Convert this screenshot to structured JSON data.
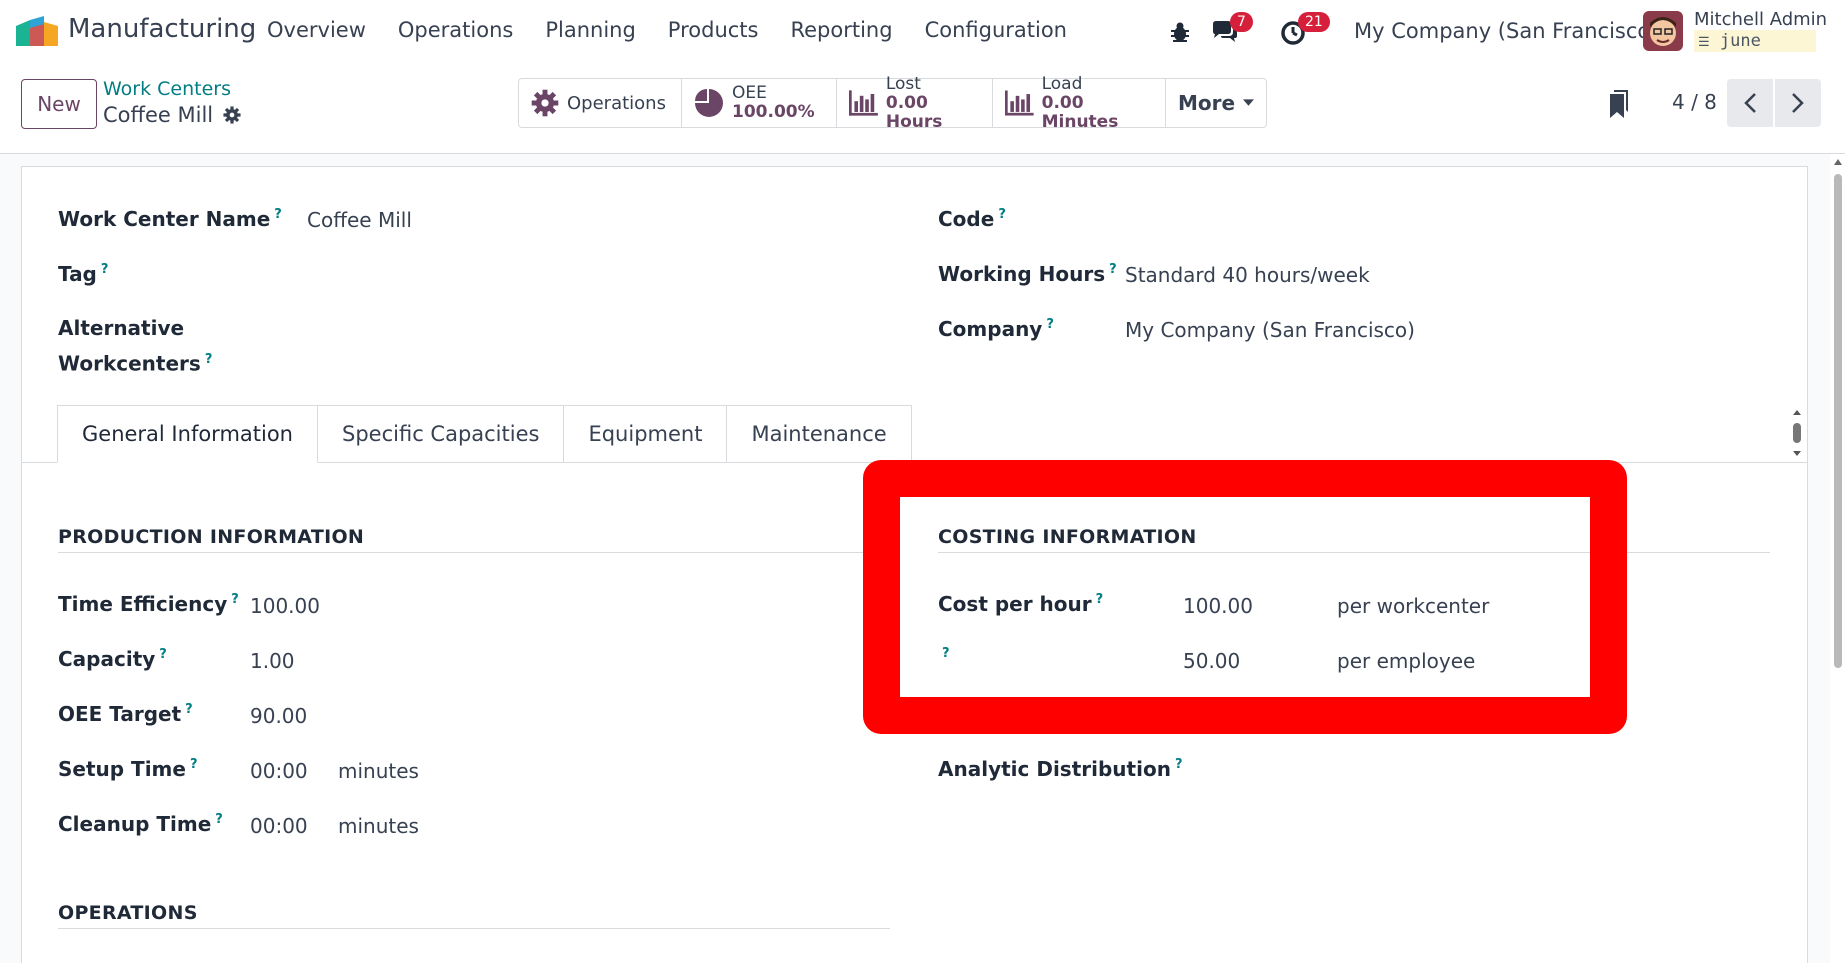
{
  "navbar": {
    "app_name": "Manufacturing",
    "menu": [
      "Overview",
      "Operations",
      "Planning",
      "Products",
      "Reporting",
      "Configuration"
    ],
    "messages_count": "7",
    "activities_count": "21",
    "company": "My Company (San Francisco)",
    "user_name": "Mitchell Admin",
    "database": "june"
  },
  "control_panel": {
    "new_label": "New",
    "breadcrumb": "Work Centers",
    "record_name": "Coffee Mill",
    "smart_buttons": {
      "operations": "Operations",
      "oee_label": "OEE",
      "oee_value": "100.00%",
      "lost_label": "Lost",
      "lost_value": "0.00 Hours",
      "load_label": "Load",
      "load_value": "0.00 Minutes",
      "more": "More"
    },
    "pager": "4 / 8"
  },
  "form": {
    "work_center_name_label": "Work Center Name",
    "work_center_name": "Coffee Mill",
    "tag_label": "Tag",
    "alternative_label_1": "Alternative",
    "alternative_label_2": "Workcenters",
    "code_label": "Code",
    "working_hours_label": "Working Hours",
    "working_hours": "Standard 40 hours/week",
    "company_label": "Company",
    "company": "My Company (San Francisco)",
    "help_mark": "?"
  },
  "tabs": [
    "General Information",
    "Specific Capacities",
    "Equipment",
    "Maintenance"
  ],
  "production": {
    "title": "PRODUCTION INFORMATION",
    "time_efficiency_label": "Time Efficiency",
    "time_efficiency": "100.00",
    "capacity_label": "Capacity",
    "capacity": "1.00",
    "oee_target_label": "OEE Target",
    "oee_target": "90.00",
    "setup_time_label": "Setup Time",
    "setup_time": "00:00",
    "cleanup_time_label": "Cleanup Time",
    "cleanup_time": "00:00",
    "minutes": "minutes"
  },
  "costing": {
    "title": "COSTING INFORMATION",
    "cost_per_hour_label": "Cost per hour",
    "cost_per_workcenter": "100.00",
    "per_workcenter": "per workcenter",
    "cost_per_employee": "50.00",
    "per_employee": "per employee",
    "analytic_label": "Analytic Distribution"
  },
  "operations_section": {
    "title": "OPERATIONS"
  },
  "colors": {
    "brand": "#6b4566",
    "link": "#017e84",
    "highlight": "#ff0000",
    "badge": "#d61f3a"
  }
}
